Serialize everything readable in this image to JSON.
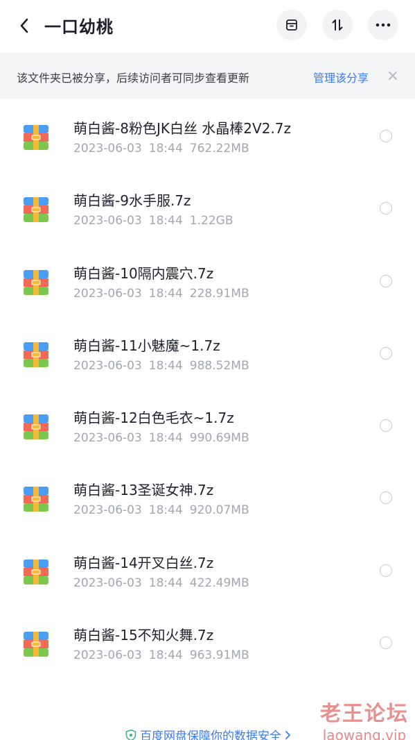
{
  "header": {
    "title": "一口幼桃"
  },
  "share_banner": {
    "message": "该文件夹已被分享，后续访问者可同步查看更新",
    "manage_label": "管理该分享"
  },
  "files": [
    {
      "name": "萌白酱-8粉色JK白丝 水晶棒2V2.7z",
      "date": "2023-06-03",
      "time": "18:44",
      "size": "762.22MB"
    },
    {
      "name": "萌白酱-9水手服.7z",
      "date": "2023-06-03",
      "time": "18:44",
      "size": "1.22GB"
    },
    {
      "name": "萌白酱-10隔内震穴.7z",
      "date": "2023-06-03",
      "time": "18:44",
      "size": "228.91MB"
    },
    {
      "name": "萌白酱-11小魅魔~1.7z",
      "date": "2023-06-03",
      "time": "18:44",
      "size": "988.52MB"
    },
    {
      "name": "萌白酱-12白色毛衣~1.7z",
      "date": "2023-06-03",
      "time": "18:44",
      "size": "990.69MB"
    },
    {
      "name": "萌白酱-13圣诞女神.7z",
      "date": "2023-06-03",
      "time": "18:44",
      "size": "920.07MB"
    },
    {
      "name": "萌白酱-14开叉白丝.7z",
      "date": "2023-06-03",
      "time": "18:44",
      "size": "422.49MB"
    },
    {
      "name": "萌白酱-15不知火舞.7z",
      "date": "2023-06-03",
      "time": "18:44",
      "size": "963.91MB"
    }
  ],
  "footer": {
    "security_text": "百度网盘保障你的数据安全"
  },
  "watermark": {
    "title": "老王论坛",
    "subtitle": "laowang.vip"
  },
  "colors": {
    "accent": "#3a7bf0",
    "banner_bg": "#f4f5f7",
    "meta_text": "#a3a7b1"
  }
}
